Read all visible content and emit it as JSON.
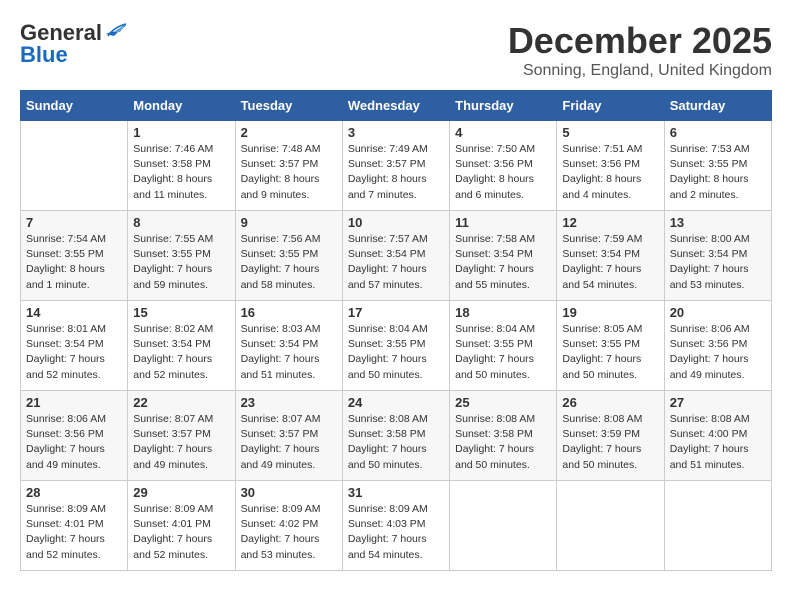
{
  "logo": {
    "line1": "General",
    "line2": "Blue"
  },
  "title": "December 2025",
  "location": "Sonning, England, United Kingdom",
  "weekdays": [
    "Sunday",
    "Monday",
    "Tuesday",
    "Wednesday",
    "Thursday",
    "Friday",
    "Saturday"
  ],
  "weeks": [
    [
      {
        "day": "",
        "sunrise": "",
        "sunset": "",
        "daylight": ""
      },
      {
        "day": "1",
        "sunrise": "Sunrise: 7:46 AM",
        "sunset": "Sunset: 3:58 PM",
        "daylight": "Daylight: 8 hours and 11 minutes."
      },
      {
        "day": "2",
        "sunrise": "Sunrise: 7:48 AM",
        "sunset": "Sunset: 3:57 PM",
        "daylight": "Daylight: 8 hours and 9 minutes."
      },
      {
        "day": "3",
        "sunrise": "Sunrise: 7:49 AM",
        "sunset": "Sunset: 3:57 PM",
        "daylight": "Daylight: 8 hours and 7 minutes."
      },
      {
        "day": "4",
        "sunrise": "Sunrise: 7:50 AM",
        "sunset": "Sunset: 3:56 PM",
        "daylight": "Daylight: 8 hours and 6 minutes."
      },
      {
        "day": "5",
        "sunrise": "Sunrise: 7:51 AM",
        "sunset": "Sunset: 3:56 PM",
        "daylight": "Daylight: 8 hours and 4 minutes."
      },
      {
        "day": "6",
        "sunrise": "Sunrise: 7:53 AM",
        "sunset": "Sunset: 3:55 PM",
        "daylight": "Daylight: 8 hours and 2 minutes."
      }
    ],
    [
      {
        "day": "7",
        "sunrise": "Sunrise: 7:54 AM",
        "sunset": "Sunset: 3:55 PM",
        "daylight": "Daylight: 8 hours and 1 minute."
      },
      {
        "day": "8",
        "sunrise": "Sunrise: 7:55 AM",
        "sunset": "Sunset: 3:55 PM",
        "daylight": "Daylight: 7 hours and 59 minutes."
      },
      {
        "day": "9",
        "sunrise": "Sunrise: 7:56 AM",
        "sunset": "Sunset: 3:55 PM",
        "daylight": "Daylight: 7 hours and 58 minutes."
      },
      {
        "day": "10",
        "sunrise": "Sunrise: 7:57 AM",
        "sunset": "Sunset: 3:54 PM",
        "daylight": "Daylight: 7 hours and 57 minutes."
      },
      {
        "day": "11",
        "sunrise": "Sunrise: 7:58 AM",
        "sunset": "Sunset: 3:54 PM",
        "daylight": "Daylight: 7 hours and 55 minutes."
      },
      {
        "day": "12",
        "sunrise": "Sunrise: 7:59 AM",
        "sunset": "Sunset: 3:54 PM",
        "daylight": "Daylight: 7 hours and 54 minutes."
      },
      {
        "day": "13",
        "sunrise": "Sunrise: 8:00 AM",
        "sunset": "Sunset: 3:54 PM",
        "daylight": "Daylight: 7 hours and 53 minutes."
      }
    ],
    [
      {
        "day": "14",
        "sunrise": "Sunrise: 8:01 AM",
        "sunset": "Sunset: 3:54 PM",
        "daylight": "Daylight: 7 hours and 52 minutes."
      },
      {
        "day": "15",
        "sunrise": "Sunrise: 8:02 AM",
        "sunset": "Sunset: 3:54 PM",
        "daylight": "Daylight: 7 hours and 52 minutes."
      },
      {
        "day": "16",
        "sunrise": "Sunrise: 8:03 AM",
        "sunset": "Sunset: 3:54 PM",
        "daylight": "Daylight: 7 hours and 51 minutes."
      },
      {
        "day": "17",
        "sunrise": "Sunrise: 8:04 AM",
        "sunset": "Sunset: 3:55 PM",
        "daylight": "Daylight: 7 hours and 50 minutes."
      },
      {
        "day": "18",
        "sunrise": "Sunrise: 8:04 AM",
        "sunset": "Sunset: 3:55 PM",
        "daylight": "Daylight: 7 hours and 50 minutes."
      },
      {
        "day": "19",
        "sunrise": "Sunrise: 8:05 AM",
        "sunset": "Sunset: 3:55 PM",
        "daylight": "Daylight: 7 hours and 50 minutes."
      },
      {
        "day": "20",
        "sunrise": "Sunrise: 8:06 AM",
        "sunset": "Sunset: 3:56 PM",
        "daylight": "Daylight: 7 hours and 49 minutes."
      }
    ],
    [
      {
        "day": "21",
        "sunrise": "Sunrise: 8:06 AM",
        "sunset": "Sunset: 3:56 PM",
        "daylight": "Daylight: 7 hours and 49 minutes."
      },
      {
        "day": "22",
        "sunrise": "Sunrise: 8:07 AM",
        "sunset": "Sunset: 3:57 PM",
        "daylight": "Daylight: 7 hours and 49 minutes."
      },
      {
        "day": "23",
        "sunrise": "Sunrise: 8:07 AM",
        "sunset": "Sunset: 3:57 PM",
        "daylight": "Daylight: 7 hours and 49 minutes."
      },
      {
        "day": "24",
        "sunrise": "Sunrise: 8:08 AM",
        "sunset": "Sunset: 3:58 PM",
        "daylight": "Daylight: 7 hours and 50 minutes."
      },
      {
        "day": "25",
        "sunrise": "Sunrise: 8:08 AM",
        "sunset": "Sunset: 3:58 PM",
        "daylight": "Daylight: 7 hours and 50 minutes."
      },
      {
        "day": "26",
        "sunrise": "Sunrise: 8:08 AM",
        "sunset": "Sunset: 3:59 PM",
        "daylight": "Daylight: 7 hours and 50 minutes."
      },
      {
        "day": "27",
        "sunrise": "Sunrise: 8:08 AM",
        "sunset": "Sunset: 4:00 PM",
        "daylight": "Daylight: 7 hours and 51 minutes."
      }
    ],
    [
      {
        "day": "28",
        "sunrise": "Sunrise: 8:09 AM",
        "sunset": "Sunset: 4:01 PM",
        "daylight": "Daylight: 7 hours and 52 minutes."
      },
      {
        "day": "29",
        "sunrise": "Sunrise: 8:09 AM",
        "sunset": "Sunset: 4:01 PM",
        "daylight": "Daylight: 7 hours and 52 minutes."
      },
      {
        "day": "30",
        "sunrise": "Sunrise: 8:09 AM",
        "sunset": "Sunset: 4:02 PM",
        "daylight": "Daylight: 7 hours and 53 minutes."
      },
      {
        "day": "31",
        "sunrise": "Sunrise: 8:09 AM",
        "sunset": "Sunset: 4:03 PM",
        "daylight": "Daylight: 7 hours and 54 minutes."
      },
      {
        "day": "",
        "sunrise": "",
        "sunset": "",
        "daylight": ""
      },
      {
        "day": "",
        "sunrise": "",
        "sunset": "",
        "daylight": ""
      },
      {
        "day": "",
        "sunrise": "",
        "sunset": "",
        "daylight": ""
      }
    ]
  ]
}
